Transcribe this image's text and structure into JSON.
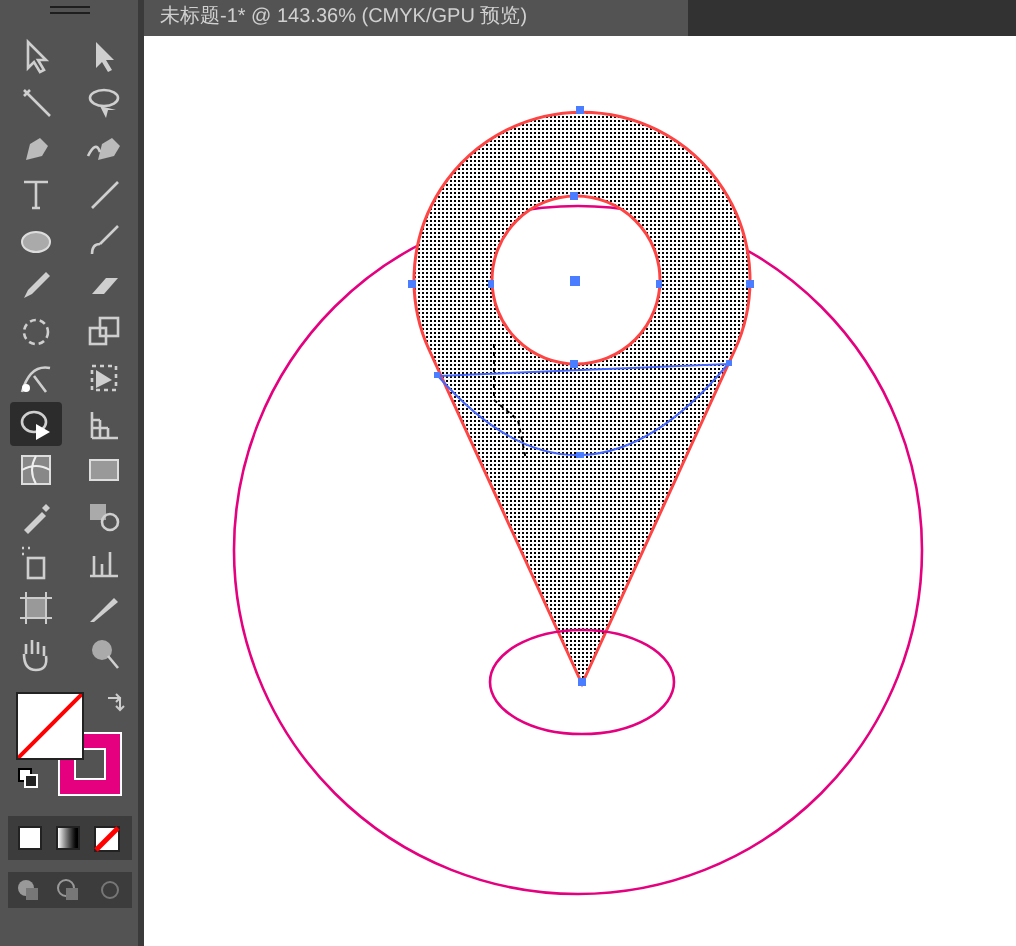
{
  "document_tab": {
    "title": "未标题-1* @ 143.36% (CMYK/GPU 预览)"
  },
  "tools": [
    {
      "selected": false
    },
    {
      "selected": false
    },
    {
      "selected": false
    },
    {
      "selected": false
    },
    {
      "selected": false
    },
    {
      "selected": false
    },
    {
      "selected": false
    },
    {
      "selected": false
    },
    {
      "selected": false
    },
    {
      "selected": false
    },
    {
      "selected": false
    },
    {
      "selected": false
    },
    {
      "selected": false
    },
    {
      "selected": false
    },
    {
      "selected": false
    },
    {
      "selected": false
    },
    {
      "selected": true
    },
    {
      "selected": false
    },
    {
      "selected": false
    },
    {
      "selected": false
    },
    {
      "selected": false
    },
    {
      "selected": false
    },
    {
      "selected": false
    },
    {
      "selected": false
    },
    {
      "selected": false
    },
    {
      "selected": false
    },
    {
      "selected": false
    },
    {
      "selected": false
    }
  ]
}
